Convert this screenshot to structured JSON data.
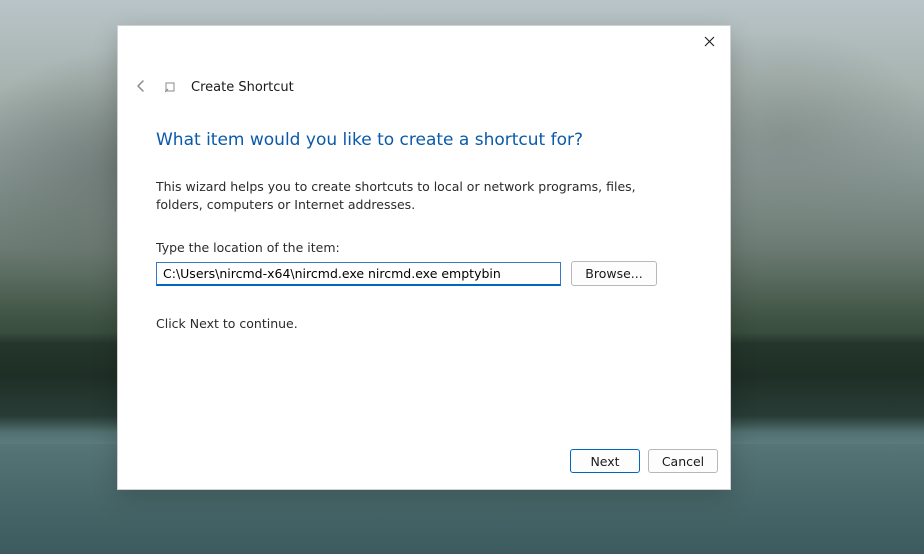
{
  "dialog": {
    "title": "Create Shortcut",
    "heading": "What item would you like to create a shortcut for?",
    "description": "This wizard helps you to create shortcuts to local or network programs, files, folders, computers or Internet addresses.",
    "field_label": "Type the location of the item:",
    "location_value": "C:\\Users\\nircmd-x64\\nircmd.exe nircmd.exe emptybin",
    "browse_label": "Browse...",
    "continue_text": "Click Next to continue.",
    "footer": {
      "next_label": "Next",
      "cancel_label": "Cancel"
    }
  }
}
